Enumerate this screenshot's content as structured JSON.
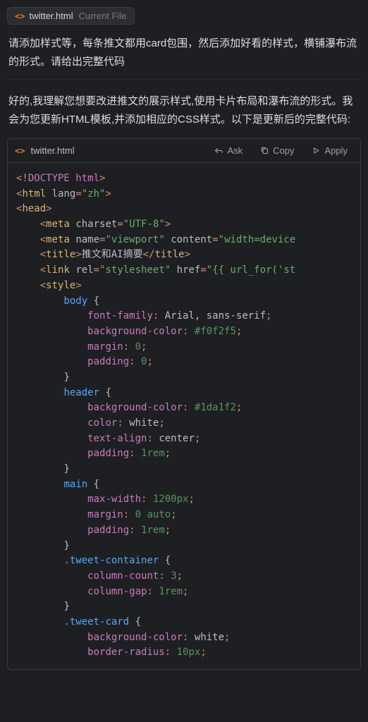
{
  "fileChip": {
    "filename": "twitter.html",
    "subtitle": "Current File"
  },
  "userMessage": "请添加样式等，每条推文都用card包围，然后添加好看的样式，横铺瀑布流的形式。请给出完整代码",
  "assistantMessage": "好的,我理解您想要改进推文的展示样式,使用卡片布局和瀑布流的形式。我会为您更新HTML模板,并添加相应的CSS样式。以下是更新后的完整代码:",
  "codeHeader": {
    "filename": "twitter.html",
    "actions": {
      "ask": "Ask",
      "copy": "Copy",
      "apply": "Apply"
    }
  },
  "code": {
    "doctype": "DOCTYPE html",
    "htmlOpen": "html",
    "langAttr": "lang",
    "langVal": "\"zh\"",
    "headOpen": "head",
    "meta1Tag": "meta",
    "meta1Attr": "charset",
    "meta1Val": "\"UTF-8\"",
    "meta2Tag": "meta",
    "meta2Attr1": "name",
    "meta2Val1": "\"viewport\"",
    "meta2Attr2": "content",
    "meta2Val2": "\"width=device",
    "titleTag": "title",
    "titleText": "推文和AI摘要",
    "linkTag": "link",
    "linkAttr1": "rel",
    "linkVal1": "\"stylesheet\"",
    "linkAttr2": "href",
    "linkVal2": "\"{{ url_for('st",
    "styleTag": "style",
    "selBody": "body",
    "propFontFamily": "font-family",
    "valFontFamily": "Arial, sans-serif",
    "propBgColor": "background-color",
    "valBodyBg": "#f0f2f5",
    "propMargin": "margin",
    "valZero": "0",
    "propPadding": "padding",
    "selHeader": "header",
    "valHeaderBg": "#1da1f2",
    "propColor": "color",
    "valWhite": "white",
    "propTextAlign": "text-align",
    "valCenter": "center",
    "val1rem": "1rem",
    "selMain": "main",
    "propMaxWidth": "max-width",
    "val1200px": "1200px",
    "valAuto": "0 auto",
    "selTweetContainer": ".tweet-container",
    "propColCount": "column-count",
    "val3": "3",
    "propColGap": "column-gap",
    "selTweetCard": ".tweet-card",
    "propBorderRadius": "border-radius",
    "val10px": "10px"
  }
}
